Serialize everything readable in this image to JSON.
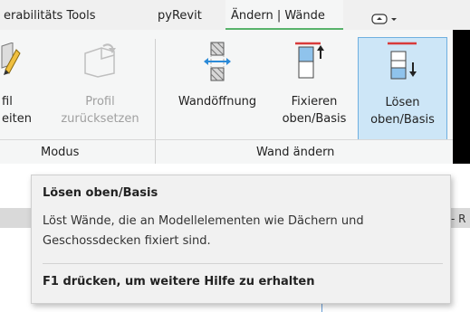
{
  "tabs": [
    {
      "label": "erabilitäts Tools"
    },
    {
      "label": "pyRevit"
    },
    {
      "label": "Ändern | Wände"
    }
  ],
  "quick_access": {
    "icon": "dropdown-icon"
  },
  "ribbon": {
    "panels": [
      {
        "title": "Modus"
      },
      {
        "title": "Wand ändern"
      }
    ],
    "buttons": [
      {
        "label": "fil\neiten",
        "enabled": true
      },
      {
        "label": "Profil\nzurücksetzen",
        "enabled": false
      },
      {
        "label": "Wandöffnung",
        "enabled": true
      },
      {
        "label": "Fixieren\noben/Basis",
        "enabled": true
      },
      {
        "label": "Lösen\noben/Basis",
        "enabled": true,
        "selected": true
      }
    ]
  },
  "tooltip": {
    "title": "Lösen oben/Basis",
    "body": "Löst Wände, die an Modellelementen wie Dächern und Geschossdecken fixiert sind.",
    "help": "F1 drücken, um weitere Hilfe zu erhalten"
  },
  "edge_text": "- R",
  "colors": {
    "accent": "#58b36b",
    "selected": "#cde6f7"
  }
}
